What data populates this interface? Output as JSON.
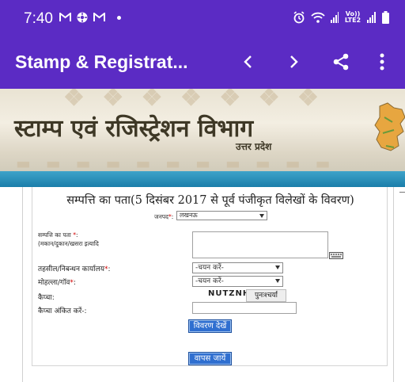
{
  "status_bar": {
    "time": "7:40",
    "notif_icons": [
      "gmail-icon",
      "settings-wheel-icon",
      "gmail-icon"
    ],
    "network_label": "Vo)) LTE2"
  },
  "app_bar": {
    "title": "Stamp & Registrat...",
    "background": "#5b2bc4"
  },
  "banner": {
    "title": "स्टाम्प एवं रजिस्ट्रेशन विभाग",
    "subtitle": "उत्तर प्रदेश"
  },
  "form": {
    "title": "सम्पत्ति का पता(5 दिसंबर 2017 से पूर्व पंजीकृत विलेखों के विवरण)",
    "district_label": "जनपद",
    "district_value": "लखनऊ",
    "address_label": "सम्पत्ति का पता",
    "address_hint": "(मकान/दुकान/खसरा इत्यादि",
    "tehsil_label": "तहसील/निबन्धन कार्यालय",
    "tehsil_value": "-चयन करें-",
    "mohalla_label": "मोहल्ला/गॉव",
    "mohalla_value": "-चयन करें-",
    "captcha_label": "कैप्चा:",
    "captcha_text": "NUTZNH",
    "refresh_label": "पुनःश्चर्या",
    "captcha_entry_label": "कैप्चा अंकित करें-:",
    "view_button": "विवरण देखें",
    "back_button": "वापस जायें"
  }
}
